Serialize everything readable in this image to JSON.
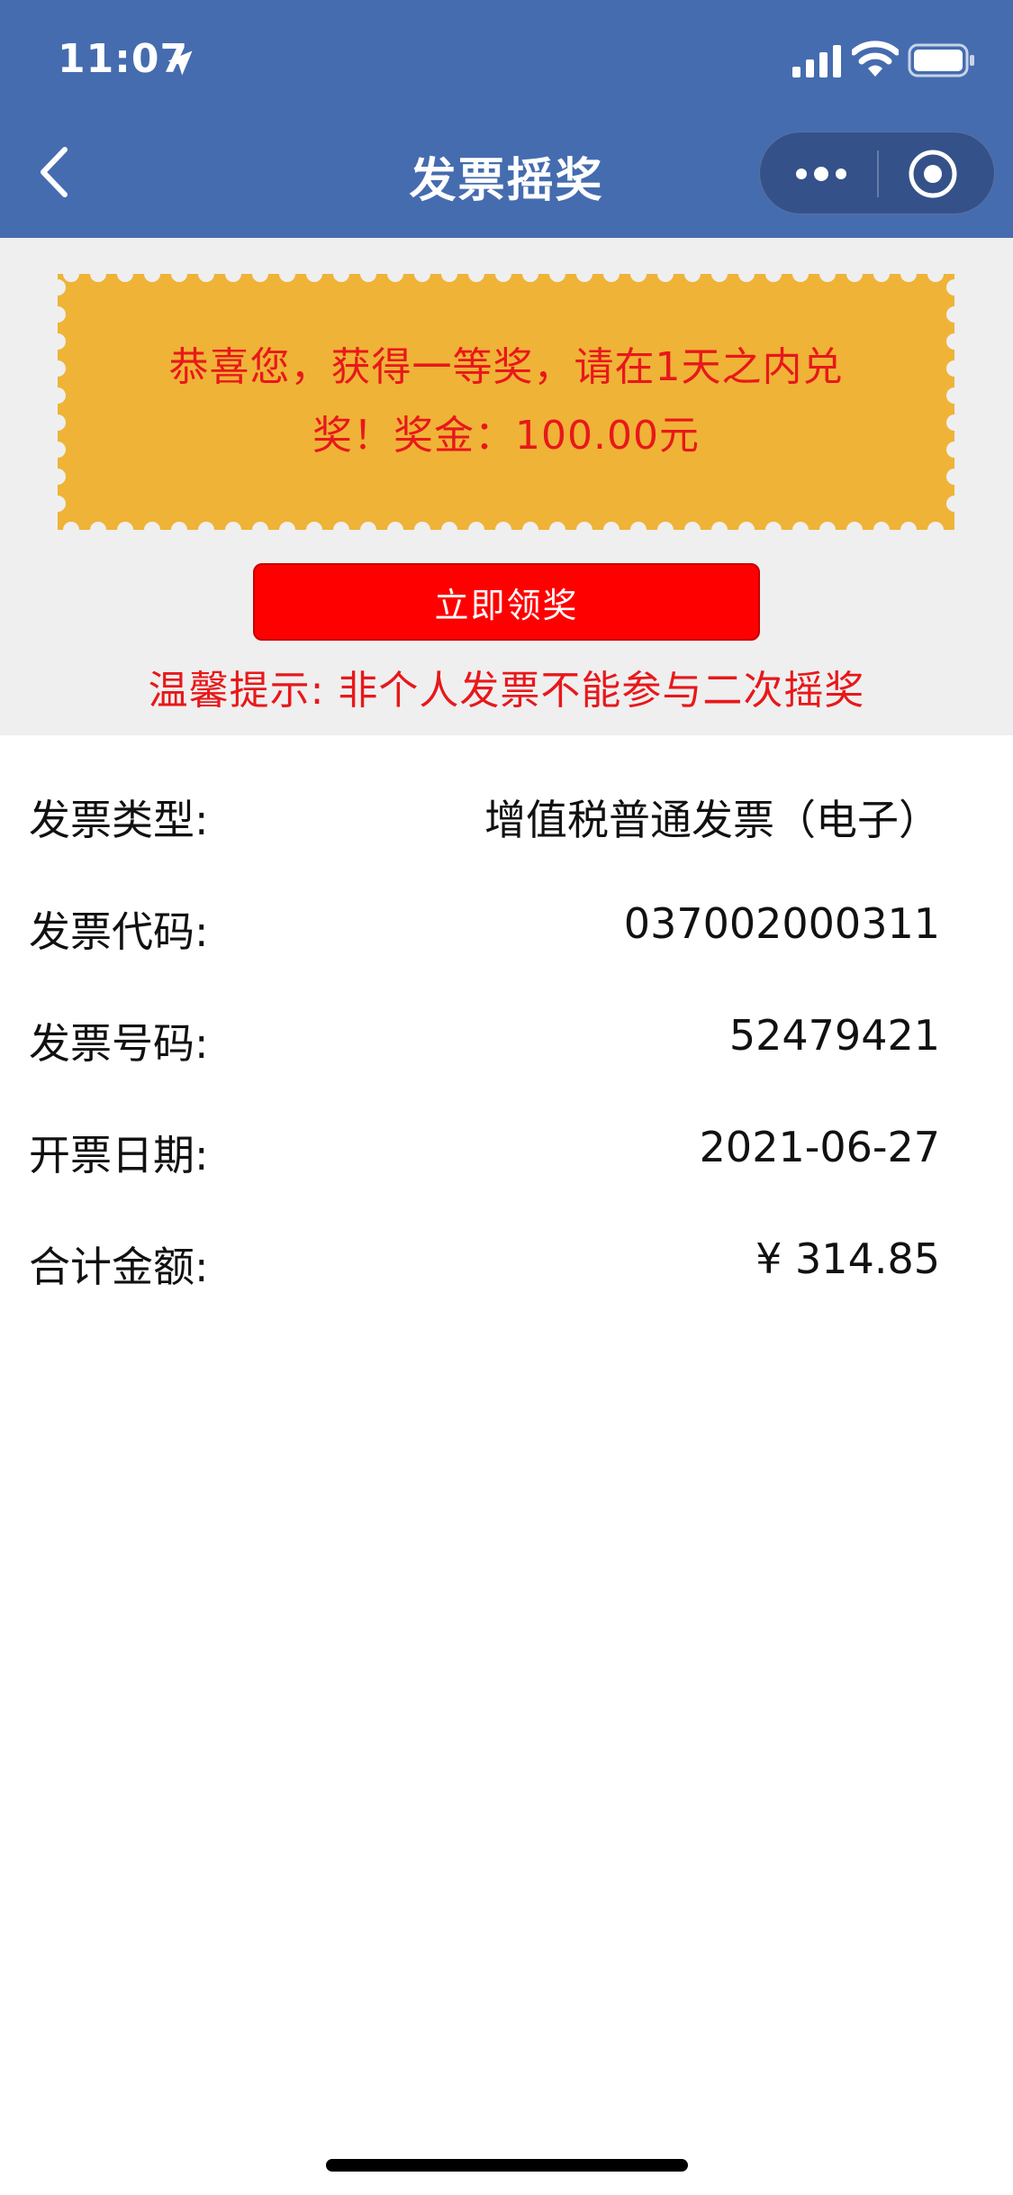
{
  "status_bar": {
    "time": "11:07"
  },
  "nav": {
    "title": "发票摇奖"
  },
  "prize": {
    "message_line1": "恭喜您，获得一等奖，请在1天之内兑",
    "message_line2": "奖！奖金：100.00元",
    "claim_label": "立即领奖",
    "tip": "温馨提示: 非个人发票不能参与二次摇奖"
  },
  "invoice": {
    "rows": [
      {
        "label": "发票类型:",
        "value": "增值税普通发票（电子）"
      },
      {
        "label": "发票代码:",
        "value": "037002000311"
      },
      {
        "label": "发票号码:",
        "value": "52479421"
      },
      {
        "label": "开票日期:",
        "value": "2021-06-27"
      },
      {
        "label": "合计金额:",
        "value": "¥ 314.85"
      }
    ]
  },
  "colors": {
    "header_bg": "#456caf",
    "ticket_bg": "#efb337",
    "accent_red": "#e8181a",
    "button_red": "#ff0000",
    "page_grey": "#efeff0"
  }
}
